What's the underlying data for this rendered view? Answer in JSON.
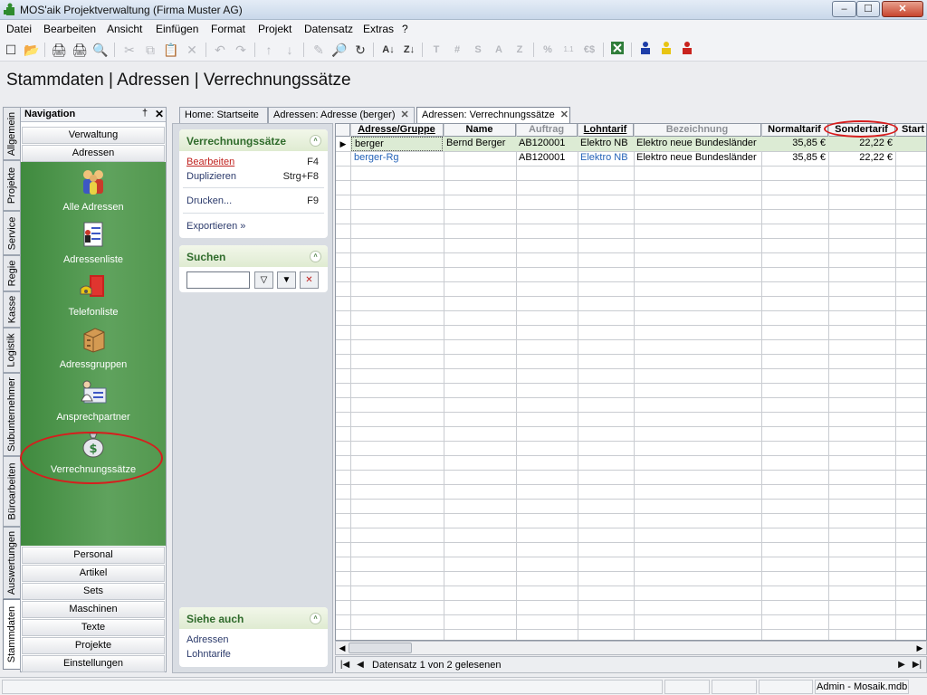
{
  "window": {
    "title": "MOS'aik Projektverwaltung (Firma Muster AG)",
    "min": "–",
    "max": "☐",
    "close": "✕"
  },
  "menu": [
    "Datei",
    "Bearbeiten",
    "Ansicht",
    "Einfügen",
    "Format",
    "Projekt",
    "Datensatz",
    "Extras",
    "?"
  ],
  "toolbar": {
    "glyphs": [
      "☐",
      "📂",
      "🖨",
      "🔍",
      "✂",
      "⧉",
      "📋",
      "✕",
      "↶",
      "↷",
      "↑",
      "↓",
      "✎",
      "🔎",
      "↻",
      "A↓",
      "Z↓"
    ],
    "letters": [
      "T",
      "#",
      "S",
      "A",
      "Z",
      "%",
      "1.1",
      "€$"
    ]
  },
  "page_title": "Stammdaten | Adressen | Verrechnungssätze",
  "side_tabs": [
    "Allgemein",
    "Projekte",
    "Service",
    "Regie",
    "Kasse",
    "Logistik",
    "Subunternehmer",
    "Büroarbeiten",
    "Auswertungen",
    "Stammdaten"
  ],
  "navigation": {
    "title": "Navigation",
    "pin": "†",
    "close": "✕",
    "top_buttons": [
      "Verwaltung",
      "Adressen"
    ],
    "items": [
      "Alle Adressen",
      "Adressenliste",
      "Telefonliste",
      "Adressgruppen",
      "Ansprechpartner",
      "Verrechnungssätze"
    ],
    "bottom_buttons": [
      "Personal",
      "Artikel",
      "Sets",
      "Maschinen",
      "Texte",
      "Projekte",
      "Einstellungen"
    ]
  },
  "doc_tabs": [
    "Home: Startseite",
    "Adressen: Adresse (berger)",
    "Adressen: Verrechnungssätze"
  ],
  "tab_close": "✕",
  "task_panel": {
    "section1": {
      "title": "Verrechnungssätze",
      "chev": "˄",
      "actions": [
        {
          "label": "Bearbeiten",
          "key": "F4"
        },
        {
          "label": "Duplizieren",
          "key": "Strg+F8"
        },
        {
          "label": "Drucken...",
          "key": "F9"
        },
        {
          "label": "Exportieren »",
          "key": ""
        }
      ]
    },
    "section2": {
      "title": "Suchen",
      "chev": "˄",
      "buttons": [
        "▽",
        "▼",
        "✕"
      ]
    },
    "section3": {
      "title": "Siehe auch",
      "chev": "˄",
      "links": [
        "Adressen",
        "Lohntarife"
      ]
    }
  },
  "grid": {
    "columns": [
      "Adresse/Gruppe",
      "Name",
      "Auftrag",
      "Lohntarif",
      "Bezeichnung",
      "Normaltarif",
      "Sondertarif",
      "Start"
    ],
    "rows": [
      [
        "berger",
        "Bernd Berger",
        "AB120001",
        "Elektro NB",
        "Elektro neue Bundesländer",
        "35,85 €",
        "22,22 €",
        ""
      ],
      [
        "berger-Rg",
        "",
        "AB120001",
        "Elektro NB",
        "Elektro neue Bundesländer",
        "35,85 €",
        "22,22 €",
        ""
      ]
    ],
    "row_marker": "▶"
  },
  "scroll": {
    "left": "◀",
    "right": "▶"
  },
  "record_nav": {
    "first": "|◀",
    "prev": "◀",
    "next": "▶",
    "last": "▶|",
    "status": "Datensatz 1 von 2 gelesenen"
  },
  "status": {
    "user": "Admin - Mosaik.mdb"
  }
}
